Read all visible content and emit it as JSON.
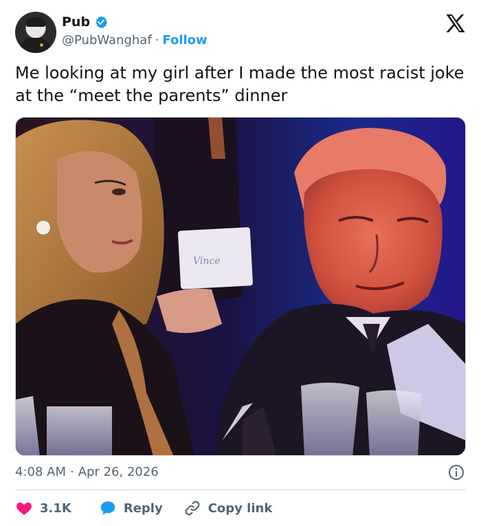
{
  "author": {
    "display_name": "Pub",
    "handle": "@PubWanghaf",
    "separator": "·",
    "follow_label": "Follow",
    "verified_color": "#1d9bf0"
  },
  "tweet": {
    "text": "Me looking at my girl after I made the most racist joke at the “meet the parents” dinner",
    "time": "4:08 AM",
    "separator": "·",
    "date": "Apr 26, 2026"
  },
  "media": {
    "card_text": "Vince"
  },
  "actions": {
    "likes_count": "3.1K",
    "reply_label": "Reply",
    "copy_link_label": "Copy link"
  },
  "colors": {
    "accent": "#1d9bf0",
    "like": "#f91880",
    "muted": "#536471",
    "text": "#0f1419"
  },
  "icons": {
    "brand": "x-logo-icon",
    "verified": "verified-badge-icon",
    "info": "info-icon",
    "like": "heart-icon",
    "reply": "speech-bubble-icon",
    "copy": "link-icon"
  }
}
